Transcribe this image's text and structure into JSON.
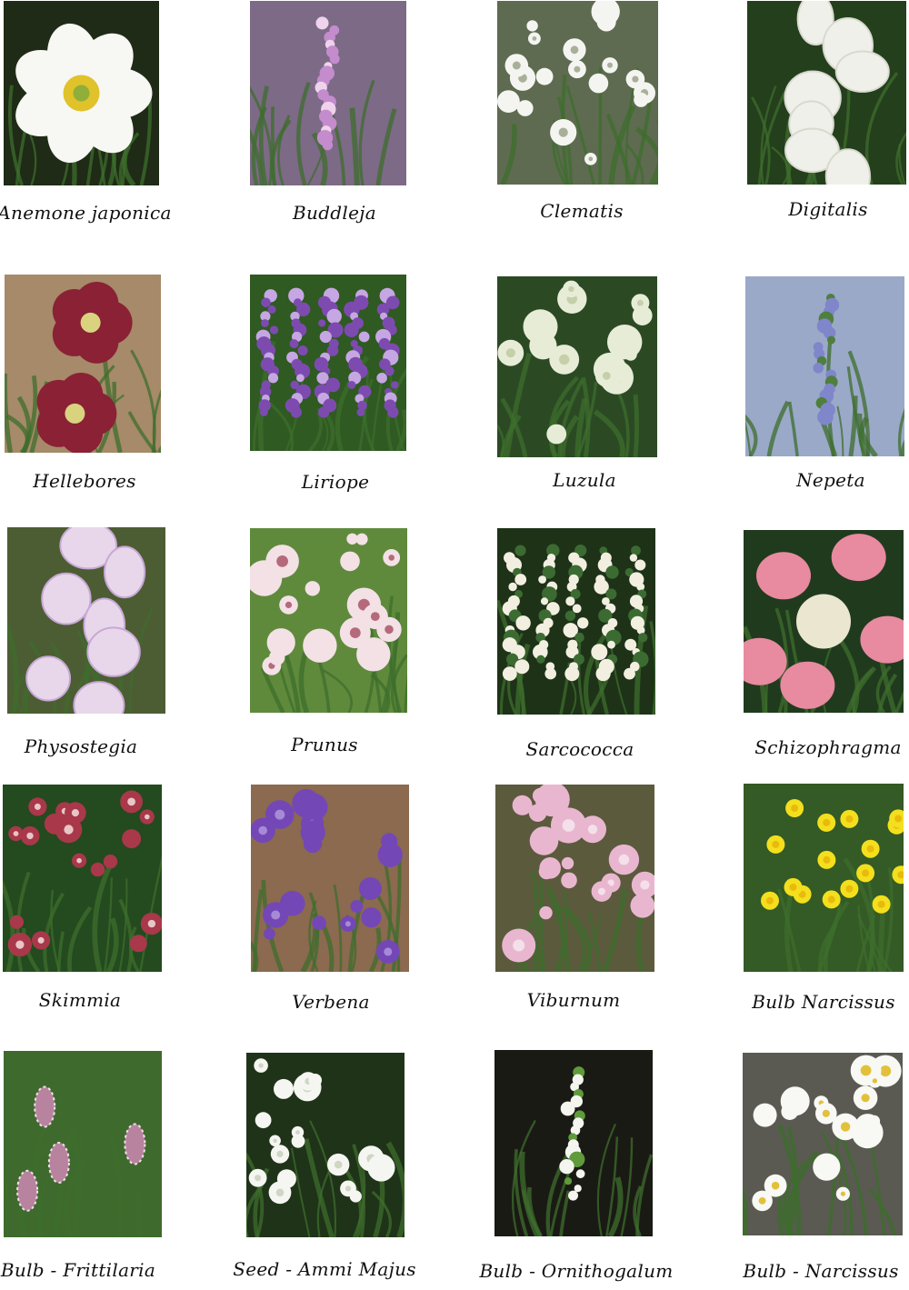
{
  "plants": [
    {
      "id": "anemone",
      "label": "Anemone japonica",
      "image": "white-anemone-flower",
      "colors": {
        "bg": "#1f2b16",
        "petal": "#f7f7f3",
        "center": "#e0c22a"
      }
    },
    {
      "id": "buddleja",
      "label": "Buddleja",
      "image": "lilac-buddleja-spike",
      "colors": {
        "bg": "#7d6a86",
        "petal": "#c48ccc",
        "center": "#efd3ec"
      }
    },
    {
      "id": "clematis",
      "label": "Clematis",
      "image": "white-star-clematis",
      "colors": {
        "bg": "#5e6b50",
        "petal": "#f4f5f1",
        "center": "#a9b09a"
      }
    },
    {
      "id": "digitalis",
      "label": "Digitalis",
      "image": "white-foxglove-bells",
      "colors": {
        "bg": "#243f1c",
        "petal": "#f0f0ea",
        "center": "#d9d9cf"
      }
    },
    {
      "id": "hellebores",
      "label": "Hellebores",
      "image": "burgundy-hellebore",
      "colors": {
        "bg": "#a68a6a",
        "petal": "#8a2135",
        "center": "#d9d37f"
      }
    },
    {
      "id": "liriope",
      "label": "Liriope",
      "image": "purple-liriope-spikes",
      "colors": {
        "bg": "#2f5a22",
        "petal": "#7d4bb0",
        "center": "#c6a7e3"
      }
    },
    {
      "id": "luzula",
      "label": "Luzula",
      "image": "cream-luzula-heads",
      "colors": {
        "bg": "#2b4a24",
        "petal": "#e7ecd7",
        "center": "#c5cfaa"
      }
    },
    {
      "id": "nepeta",
      "label": "Nepeta",
      "image": "blue-nepeta-spike",
      "colors": {
        "bg": "#9aa9c8",
        "petal": "#7f86c9",
        "center": "#4f7f3c"
      }
    },
    {
      "id": "physostegia",
      "label": "Physostegia",
      "image": "pale-pink-physostegia",
      "colors": {
        "bg": "#4d5d33",
        "petal": "#e8d7ea",
        "center": "#c8a8d6"
      }
    },
    {
      "id": "prunus",
      "label": "Prunus",
      "image": "pink-cherry-blossom",
      "colors": {
        "bg": "#5f8a3c",
        "petal": "#f3e1e6",
        "center": "#b56a7c"
      }
    },
    {
      "id": "sarcococca",
      "label": "Sarcococca",
      "image": "sarcococca-white-tassels",
      "colors": {
        "bg": "#1e3218",
        "petal": "#f2efe1",
        "center": "#3c6b32"
      }
    },
    {
      "id": "schizophragma",
      "label": "Schizophragma",
      "image": "pink-bract-schizophragma",
      "colors": {
        "bg": "#203a1e",
        "petal": "#e88aa0",
        "center": "#eae6cf"
      }
    },
    {
      "id": "skimmia",
      "label": "Skimmia",
      "image": "red-skimmia-buds",
      "colors": {
        "bg": "#244a1f",
        "petal": "#a8384a",
        "center": "#e8c6c6"
      }
    },
    {
      "id": "verbena",
      "label": "Verbena",
      "image": "purple-verbena-clusters",
      "colors": {
        "bg": "#8b6a4f",
        "petal": "#7447b7",
        "center": "#a68ad6"
      }
    },
    {
      "id": "viburnum",
      "label": "Viburnum",
      "image": "pink-viburnum-clusters",
      "colors": {
        "bg": "#5b5a3d",
        "petal": "#e9b6cf",
        "center": "#f4e0ea"
      }
    },
    {
      "id": "narcissus-bulb",
      "label": "Bulb Narcissus",
      "image": "yellow-daffodils",
      "colors": {
        "bg": "#345a25",
        "petal": "#f3df1d",
        "center": "#e9b90c"
      }
    },
    {
      "id": "fritillaria",
      "label": "Bulb - Frittilaria",
      "image": "chequered-fritillaria",
      "colors": {
        "bg": "#3f6a2d",
        "petal": "#b8839e",
        "center": "#efe0ea"
      }
    },
    {
      "id": "ammi",
      "label": "Seed - Ammi Majus",
      "image": "white-ammi-umbels",
      "colors": {
        "bg": "#1f3319",
        "petal": "#f5f6f1",
        "center": "#cfd6c4"
      }
    },
    {
      "id": "ornithogalum",
      "label": "Bulb - Ornithogalum",
      "image": "white-ornithogalum-spike",
      "colors": {
        "bg": "#1a1a14",
        "petal": "#f4f5ef",
        "center": "#5f9a3b"
      }
    },
    {
      "id": "narcissus-white",
      "label": "Bulb - Narcissus",
      "image": "white-paperwhite-narcissus",
      "colors": {
        "bg": "#5a5a52",
        "petal": "#f8f8f4",
        "center": "#e2c13a"
      }
    }
  ]
}
